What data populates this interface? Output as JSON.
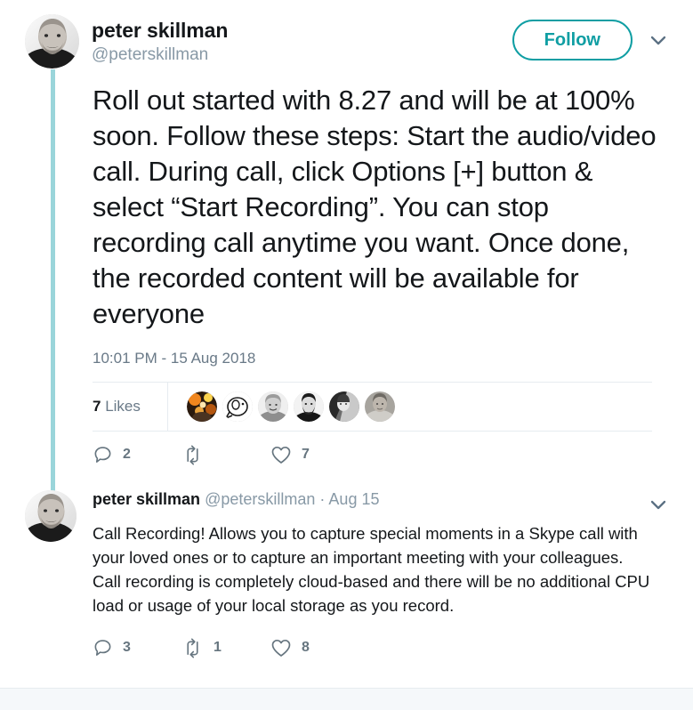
{
  "theme": {
    "accent": "#0f9ea3",
    "thread_line": "#9ad5da",
    "text": "#14171a",
    "muted": "#8899a6",
    "action_icon": "#66757f",
    "divider": "#e6ecf0",
    "footer": "#f5f8fa"
  },
  "main_tweet": {
    "display_name": "peter skillman",
    "handle": "@peterskillman",
    "avatar_alt": "peter-skillman-avatar",
    "follow_label": "Follow",
    "more_icon": "chevron-down-icon",
    "text": "Roll out started with 8.27 and will be at 100% soon. Follow these steps: Start the audio/video call. During call, click Options [+] button & select “Start Recording”. You can stop recording call anytime you want. Once done, the recorded content will be available for everyone",
    "timestamp": "10:01 PM - 15 Aug 2018",
    "likes": {
      "count": "7",
      "label": "Likes",
      "avatars": [
        "liker-avatar-1",
        "liker-avatar-2",
        "liker-avatar-3",
        "liker-avatar-4",
        "liker-avatar-5",
        "liker-avatar-6"
      ]
    },
    "actions": {
      "reply_icon": "reply-icon",
      "reply_count": "2",
      "retweet_icon": "retweet-icon",
      "retweet_count": "",
      "like_icon": "heart-icon",
      "like_count": "7"
    }
  },
  "reply_tweet": {
    "display_name": "peter skillman",
    "handle": "@peterskillman",
    "separator": "·",
    "date": "Aug 15",
    "avatar_alt": "peter-skillman-avatar",
    "more_icon": "chevron-down-icon",
    "text": "Call Recording!  Allows you to capture special moments in a Skype call with your loved ones or to capture an important meeting with your colleagues.  Call recording is completely cloud-based and there will be no additional CPU load or usage of your local storage as you record.",
    "actions": {
      "reply_icon": "reply-icon",
      "reply_count": "3",
      "retweet_icon": "retweet-icon",
      "retweet_count": "1",
      "like_icon": "heart-icon",
      "like_count": "8"
    }
  }
}
